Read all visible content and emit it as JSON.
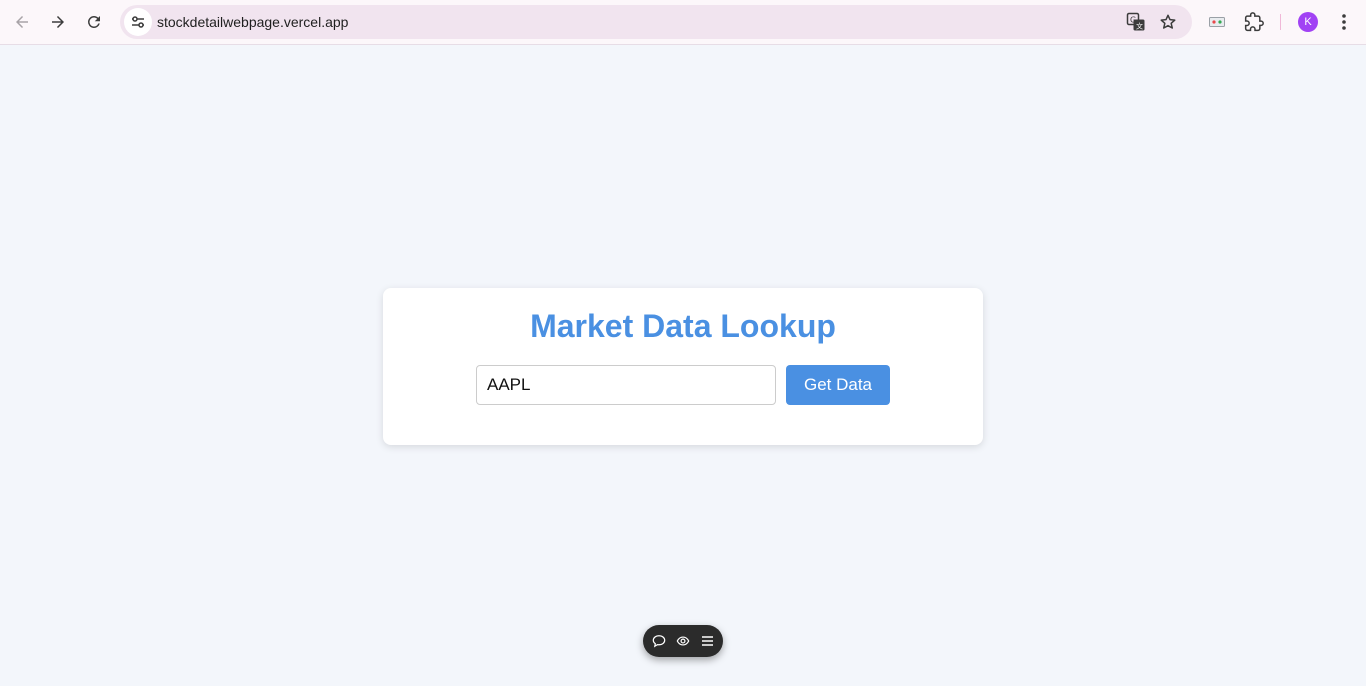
{
  "browser": {
    "url": "stockdetailwebpage.vercel.app",
    "profile_initial": "K",
    "icons": {
      "back": "arrow-left-icon",
      "forward": "arrow-right-icon",
      "reload": "reload-icon",
      "site_info": "tune-icon",
      "translate": "translate-icon",
      "bookmark": "star-icon",
      "extension_badge": "extension-badge-icon",
      "extensions": "puzzle-icon",
      "menu": "kebab-menu-icon"
    },
    "colors": {
      "omnibox": "#f1e4ef",
      "avatar": "#a142f4"
    }
  },
  "main": {
    "title": "Market Data Lookup",
    "input_value": "AAPL",
    "button_label": "Get Data",
    "colors": {
      "accent": "#4a90e2",
      "background": "#f3f6fb"
    }
  },
  "floating_toolbar": {
    "icons": [
      "comment-icon",
      "eye-icon",
      "menu-icon"
    ]
  }
}
